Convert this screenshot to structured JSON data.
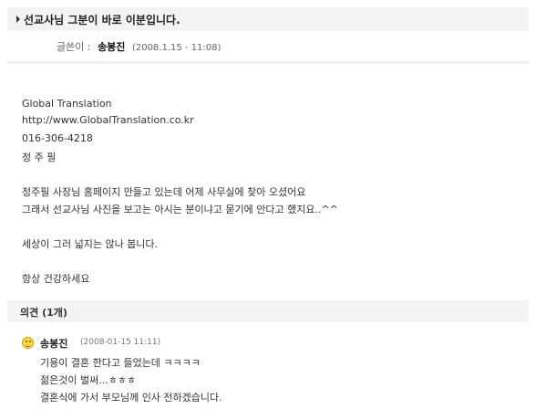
{
  "post": {
    "title": "선교사님 그분이 바로 이분입니다.",
    "meta_label": "글쓴이 :",
    "author": "송봉진",
    "date": "(2008.1.15 - 11:08)",
    "body_lines": [
      "Global Translation",
      "http://www.GlobalTranslation.co.kr",
      "016-306-4218",
      "정 주 필",
      "정주필 사장님 홈페이지 만들고 있는데 어제 사무실에 찾아 오셨어요",
      "그래서 선교사님 사진을 보고는 아시는 분이냐고 묻기에 안다고 했지요..^^",
      "세상이 그러 넓지는 않나 봅니다.",
      "항상 건강하세요"
    ]
  },
  "comments": {
    "title": "의견 (1개)",
    "items": [
      {
        "author": "송봉진",
        "date": "(2008-01-15  11:11)",
        "lines": [
          "기용이 결혼 한다고 들었는데 ㅋㅋㅋㅋ",
          "젊은것이 벌써...ㅎㅎㅎ",
          "결혼식에 가서 부모님께 인사 전하겠습니다."
        ]
      }
    ]
  }
}
